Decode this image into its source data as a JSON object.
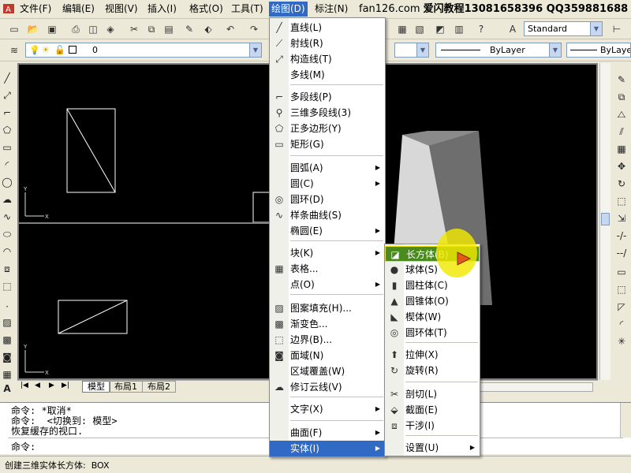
{
  "menubar": {
    "items": [
      "文件(F)",
      "编辑(E)",
      "视图(V)",
      "插入(I)",
      "格式(O)",
      "工具(T)",
      "绘图(D)",
      "标注(N)"
    ],
    "banner_site": "fan126.com",
    "banner_text": "爱闪教程13081658396 QQ359881688"
  },
  "toolbar": {
    "text_style": "Standard",
    "layer_name": "0",
    "linetype": "ByLayer",
    "lineweight": "ByLayer"
  },
  "layout_tabs": [
    "模型",
    "布局1",
    "布局2"
  ],
  "draw_menu": {
    "items": [
      {
        "label": "直线(L)",
        "icon": "line-icon"
      },
      {
        "label": "射线(R)",
        "icon": "ray-icon"
      },
      {
        "label": "构造线(T)",
        "icon": "xline-icon"
      },
      {
        "label": "多线(M)",
        "icon": ""
      },
      {
        "label": "多段线(P)",
        "icon": "polyline-icon"
      },
      {
        "label": "三维多段线(3)",
        "icon": "3dpoly-icon"
      },
      {
        "label": "正多边形(Y)",
        "icon": "polygon-icon"
      },
      {
        "label": "矩形(G)",
        "icon": "rectangle-icon"
      },
      {
        "label": "圆弧(A)",
        "icon": ""
      },
      {
        "label": "圆(C)",
        "icon": ""
      },
      {
        "label": "圆环(D)",
        "icon": "donut-icon"
      },
      {
        "label": "样条曲线(S)",
        "icon": "spline-icon"
      },
      {
        "label": "椭圆(E)",
        "icon": ""
      },
      {
        "label": "块(K)",
        "icon": ""
      },
      {
        "label": "表格...",
        "icon": "table-icon"
      },
      {
        "label": "点(O)",
        "icon": ""
      },
      {
        "label": "图案填充(H)...",
        "icon": "hatch-icon"
      },
      {
        "label": "渐变色...",
        "icon": "gradient-icon"
      },
      {
        "label": "边界(B)...",
        "icon": "boundary-icon"
      },
      {
        "label": "面域(N)",
        "icon": "region-icon"
      },
      {
        "label": "区域覆盖(W)",
        "icon": ""
      },
      {
        "label": "修订云线(V)",
        "icon": "revcloud-icon"
      },
      {
        "label": "文字(X)",
        "icon": ""
      },
      {
        "label": "曲面(F)",
        "icon": ""
      },
      {
        "label": "实体(I)",
        "icon": ""
      }
    ]
  },
  "solids_menu": {
    "items": [
      {
        "label": "长方体(B)",
        "icon": "box-icon"
      },
      {
        "label": "球体(S)",
        "icon": "sphere-icon"
      },
      {
        "label": "圆柱体(C)",
        "icon": "cylinder-icon"
      },
      {
        "label": "圆锥体(O)",
        "icon": "cone-icon"
      },
      {
        "label": "楔体(W)",
        "icon": "wedge-icon"
      },
      {
        "label": "圆环体(T)",
        "icon": "torus-icon"
      },
      {
        "label": "拉伸(X)",
        "icon": "extrude-icon"
      },
      {
        "label": "旋转(R)",
        "icon": "revolve-icon"
      },
      {
        "label": "剖切(L)",
        "icon": "slice-icon"
      },
      {
        "label": "截面(E)",
        "icon": "section-icon"
      },
      {
        "label": "干涉(I)",
        "icon": "interfere-icon"
      },
      {
        "label": "设置(U)",
        "icon": ""
      }
    ]
  },
  "command": {
    "line1": "命令: *取消*",
    "line2": "命令:  <切换到: 模型>",
    "line3": "恢复缓存的视口.",
    "prompt": "命令:"
  },
  "status": {
    "text": "创建三维实体长方体:  BOX"
  },
  "colors": {
    "highlight": "#316ac5",
    "cursor_halo": "#f2e800",
    "cursor_arrow": "#e05a18",
    "viewport_bg": "#000000"
  }
}
